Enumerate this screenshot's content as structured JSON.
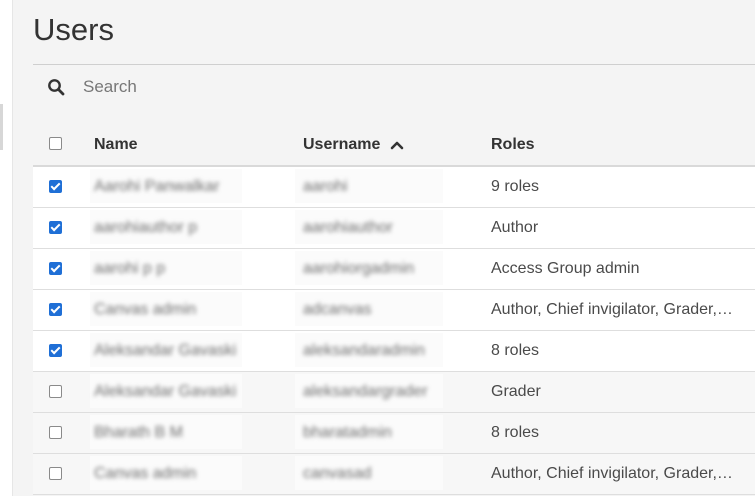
{
  "page": {
    "title": "Users"
  },
  "search": {
    "placeholder": "Search"
  },
  "table": {
    "headers": {
      "name": "Name",
      "username": "Username",
      "roles": "Roles"
    },
    "rows": [
      {
        "name": "Aarohi Panwalkar",
        "username": "aarohi",
        "roles": "9 roles",
        "checked": true
      },
      {
        "name": "aarohiauthor p",
        "username": "aarohiauthor",
        "roles": "Author",
        "checked": true
      },
      {
        "name": "aarohi p p",
        "username": "aarohiorgadmin",
        "roles": "Access Group admin",
        "checked": true
      },
      {
        "name": "Canvas admin",
        "username": "adcanvas",
        "roles": "Author, Chief invigilator, Grader, Invigilator",
        "checked": true
      },
      {
        "name": "Aleksandar Gavaski",
        "username": "aleksandaradmin",
        "roles": "8 roles",
        "checked": true
      },
      {
        "name": "Aleksandar Gavaski",
        "username": "aleksandargrader",
        "roles": "Grader",
        "checked": false
      },
      {
        "name": "Bharath B M",
        "username": "bharatadmin",
        "roles": "8 roles",
        "checked": false
      },
      {
        "name": "Canvas admin",
        "username": "canvasad",
        "roles": "Author, Chief invigilator, Grader, Invigilator",
        "checked": false
      }
    ]
  }
}
